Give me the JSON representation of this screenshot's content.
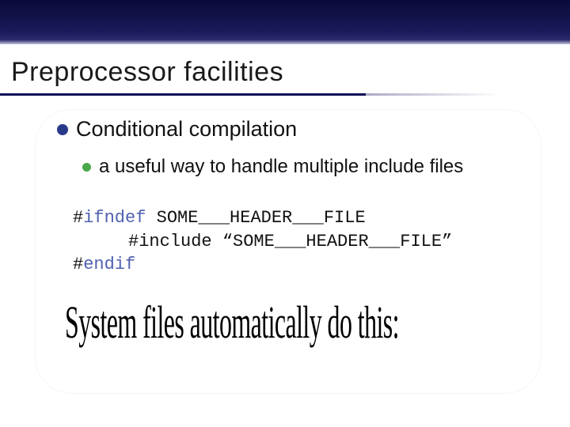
{
  "title": "Preprocessor facilities",
  "bullets": {
    "main": "Conditional compilation",
    "sub": "a useful way to handle multiple include files"
  },
  "code": {
    "line1_hash": "#",
    "line1_kw": "ifndef",
    "line1_rest": " SOME___HEADER___FILE",
    "line2": "#include “SOME___HEADER___FILE”",
    "line3_hash": "#",
    "line3_kw": "endif"
  },
  "banner": "System files automatically do this:"
}
